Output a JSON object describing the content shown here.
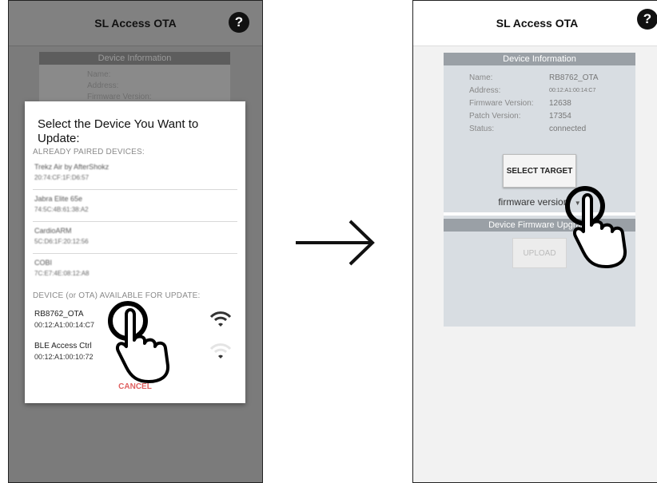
{
  "left_screen": {
    "app_title": "SL Access OTA",
    "help_icon": "question-mark-icon",
    "background_card": {
      "header": "Device Information",
      "rows": [
        "Name:",
        "Address:",
        "Firmware Version:"
      ]
    },
    "dialog": {
      "title": "Select the Device You Want to Update:",
      "paired_header": "ALREADY PAIRED DEVICES:",
      "paired_devices": [
        {
          "name": "Trekz Air by AfterShokz",
          "address": "20:74:CF:1F:D6:57"
        },
        {
          "name": "Jabra Elite 65e",
          "address": "74:5C:4B:61:38:A2"
        },
        {
          "name": "CardioARM",
          "address": "5C:D6:1F:20:12:56"
        },
        {
          "name": "COBI",
          "address": "7C:E7:4E:08:12:A8"
        }
      ],
      "ota_header": "DEVICE (or OTA) AVAILABLE FOR UPDATE:",
      "ota_devices": [
        {
          "name": "RB8762_OTA",
          "address": "00:12:A1:00:14:C7",
          "icon": "wifi-signal-strong-icon"
        },
        {
          "name": "BLE Access Ctrl",
          "address": "00:12:A1:00:10:72",
          "icon": "wifi-signal-weak-icon"
        }
      ],
      "cancel_label": "CANCEL"
    }
  },
  "right_screen": {
    "app_title": "SL Access OTA",
    "help_icon": "question-mark-icon",
    "device_info_header": "Device Information",
    "info": {
      "name_label": "Name:",
      "name_value": "RB8762_OTA",
      "address_label": "Address:",
      "address_value": "00:12:A1:00:14:C7",
      "fw_label": "Firmware Version:",
      "fw_value": "12638",
      "patch_label": "Patch Version:",
      "patch_value": "17354",
      "status_label": "Status:",
      "status_value": "connected"
    },
    "select_target_label": "SELECT TARGET",
    "firmware_version_label": "firmware version",
    "firmware_header": "Device Firmware Upgrade",
    "upload_label": "UPLOAD"
  },
  "arrow_icon": "right-arrow-icon",
  "hand_icon": "pointing-hand-icon",
  "colors": {
    "cancel": "#e06060",
    "card_header": "#9aa0a6",
    "card_bg": "#d8dde2"
  }
}
